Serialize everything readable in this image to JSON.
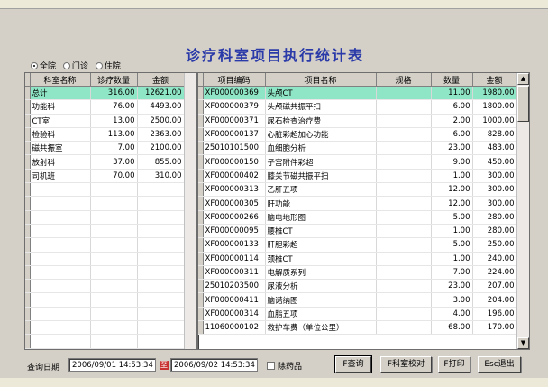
{
  "menubar": {
    "items": []
  },
  "title": "诊疗科室项目执行统计表",
  "scope": {
    "options": [
      "全院",
      "门诊",
      "住院"
    ],
    "selected": 0
  },
  "dept_table": {
    "columns": [
      "科室名称",
      "诊疗数量",
      "金额"
    ],
    "rows": [
      {
        "name": "总计",
        "qty": "316.00",
        "amount": "12621.00"
      },
      {
        "name": "功能科",
        "qty": "76.00",
        "amount": "4493.00"
      },
      {
        "name": "CT室",
        "qty": "13.00",
        "amount": "2500.00"
      },
      {
        "name": "检验科",
        "qty": "113.00",
        "amount": "2363.00"
      },
      {
        "name": "磁共振室",
        "qty": "7.00",
        "amount": "2100.00"
      },
      {
        "name": "放射科",
        "qty": "37.00",
        "amount": "855.00"
      },
      {
        "name": "司机班",
        "qty": "70.00",
        "amount": "310.00"
      }
    ],
    "selected_index": 0
  },
  "item_table": {
    "columns": [
      "项目编码",
      "项目名称",
      "规格",
      "数量",
      "金额"
    ],
    "rows": [
      {
        "code": "XF000000369",
        "name": "头颅CT",
        "spec": "",
        "qty": "11.00",
        "amount": "1980.00"
      },
      {
        "code": "XF000000379",
        "name": "头颅磁共振平扫",
        "spec": "",
        "qty": "6.00",
        "amount": "1800.00"
      },
      {
        "code": "XF000000371",
        "name": "尿石检查治疗费",
        "spec": "",
        "qty": "2.00",
        "amount": "1000.00"
      },
      {
        "code": "XF000000137",
        "name": "心脏彩超加心功能",
        "spec": "",
        "qty": "6.00",
        "amount": "828.00"
      },
      {
        "code": "25010101500",
        "name": "血细胞分析",
        "spec": "",
        "qty": "23.00",
        "amount": "483.00"
      },
      {
        "code": "XF000000150",
        "name": "子宫附件彩超",
        "spec": "",
        "qty": "9.00",
        "amount": "450.00"
      },
      {
        "code": "XF000000402",
        "name": "膝关节磁共振平扫",
        "spec": "",
        "qty": "1.00",
        "amount": "300.00"
      },
      {
        "code": "XF000000313",
        "name": "乙肝五项",
        "spec": "",
        "qty": "12.00",
        "amount": "300.00"
      },
      {
        "code": "XF000000305",
        "name": "肝功能",
        "spec": "",
        "qty": "12.00",
        "amount": "300.00"
      },
      {
        "code": "XF000000266",
        "name": "脑电地形图",
        "spec": "",
        "qty": "5.00",
        "amount": "280.00"
      },
      {
        "code": "XF000000095",
        "name": "腰椎CT",
        "spec": "",
        "qty": "1.00",
        "amount": "280.00"
      },
      {
        "code": "XF000000133",
        "name": "肝胆彩超",
        "spec": "",
        "qty": "5.00",
        "amount": "250.00"
      },
      {
        "code": "XF000000114",
        "name": "颈椎CT",
        "spec": "",
        "qty": "1.00",
        "amount": "240.00"
      },
      {
        "code": "XF000000311",
        "name": "电解质系列",
        "spec": "",
        "qty": "7.00",
        "amount": "224.00"
      },
      {
        "code": "25010203500",
        "name": "尿液分析",
        "spec": "",
        "qty": "23.00",
        "amount": "207.00"
      },
      {
        "code": "XF000000411",
        "name": "脑诺纳图",
        "spec": "",
        "qty": "3.00",
        "amount": "204.00"
      },
      {
        "code": "XF000000314",
        "name": "血脂五项",
        "spec": "",
        "qty": "4.00",
        "amount": "196.00"
      },
      {
        "code": "11060000102",
        "name": "救护车费（单位公里）",
        "spec": "",
        "qty": "68.00",
        "amount": "170.00"
      }
    ],
    "selected_index": 0
  },
  "query": {
    "date_label": "查询日期",
    "start": "2006/09/01 14:53:34",
    "to_label": "至",
    "end": "2006/09/02 14:53:34",
    "exclude_drugs_label": "除药品",
    "exclude_drugs_checked": false
  },
  "buttons": {
    "query": "F查询",
    "dept_check": "F科室校对",
    "print": "F打印",
    "exit": "Esc退出"
  },
  "colors": {
    "selection": "#8fe6c6",
    "title": "#2a3aa8",
    "window": "#d4d0c8"
  }
}
